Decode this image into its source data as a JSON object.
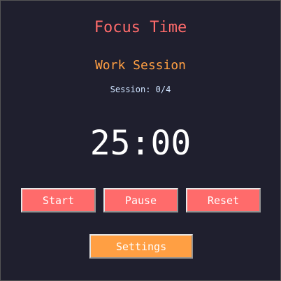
{
  "title": "Focus Time",
  "mode": "Work Session",
  "session_count": "Session: 0/4",
  "timer": "25:00",
  "buttons": {
    "start": "Start",
    "pause": "Pause",
    "reset": "Reset",
    "settings": "Settings"
  },
  "colors": {
    "background": "#1f1f2e",
    "accent_red": "#ff6b6b",
    "accent_orange": "#ff9f43"
  }
}
